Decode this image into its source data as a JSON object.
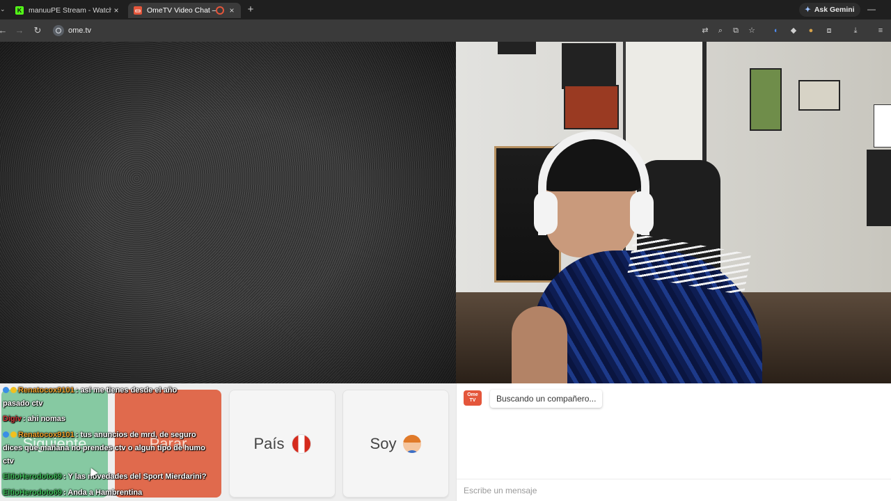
{
  "browser": {
    "tabs": [
      {
        "label": "manuuPE Stream - Watch Live",
        "favicon": "kick-icon",
        "close": "×"
      },
      {
        "label": "OmeTV Video Chat — Ome",
        "favicon": "ometv-icon",
        "close": "×"
      }
    ],
    "new_tab": "+",
    "ask_gemini": "Ask Gemini",
    "url": "ome.tv",
    "colors": {
      "tabbar": "#1f1f1f",
      "toolbar": "#3a3a3a",
      "kick_green": "#53fc18",
      "ometv_red": "#e4563b"
    }
  },
  "controls": {
    "next_label": "Siguiente",
    "stop_label": "Parar",
    "country_label": "País",
    "country_flag": "peru-flag",
    "gender_label": "Soy",
    "gender_icon": "boy-avatar-icon",
    "colors": {
      "next": "#86c9a2",
      "stop": "#e06a4d"
    }
  },
  "stream_chat": [
    {
      "user": "Renatocox9101",
      "text": ": así me tienes desde el año"
    },
    {
      "user": "",
      "text": "pasado ctv"
    },
    {
      "user": "Digiv",
      "text": ": ahi nomas"
    },
    {
      "user": "Renatocox9101",
      "text": ": tus anuncios de mrd, de seguro"
    },
    {
      "user": "",
      "text": "dices que mañana no prendes ctv o algun tipo de humo"
    },
    {
      "user": "",
      "text": "ctv"
    },
    {
      "user": "EltioHerodoto69",
      "text": ": Y las novedades del Sport Mierdarini?"
    },
    {
      "user": "EltioHerodoto69",
      "text": ": Anda a Hambrentina"
    }
  ],
  "chat": {
    "logo_text": "Ome TV",
    "status": "Buscando un compañero...",
    "input_placeholder": "Escribe un mensaje"
  }
}
